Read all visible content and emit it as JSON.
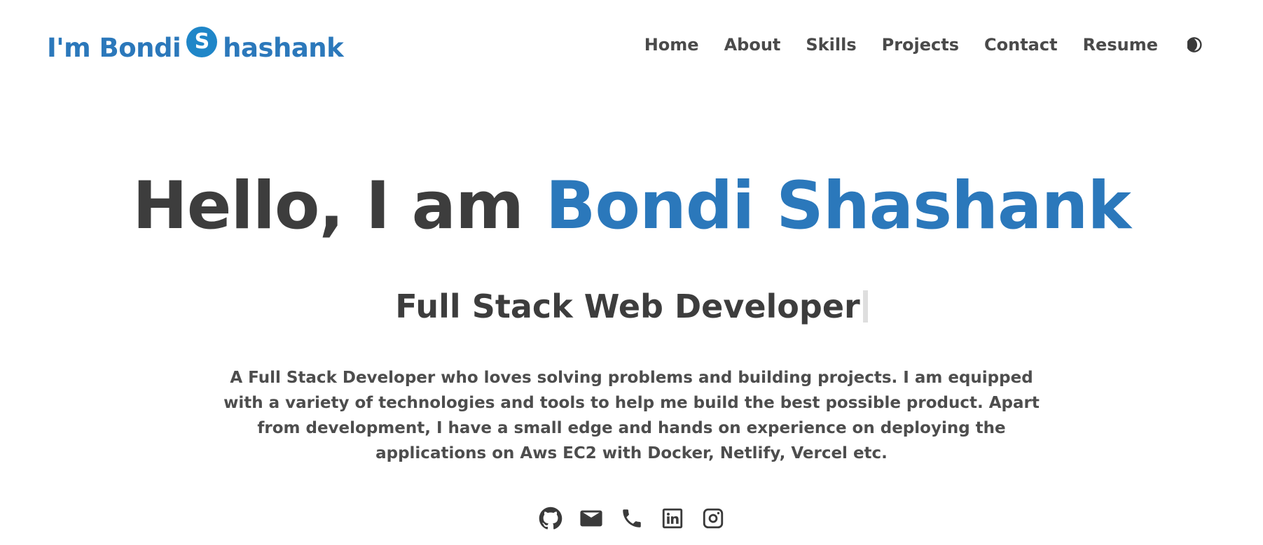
{
  "brand": {
    "prefix": "I'm Bondi",
    "badge": "S",
    "suffix": "hashank"
  },
  "nav": {
    "items": [
      {
        "label": "Home"
      },
      {
        "label": "About"
      },
      {
        "label": "Skills"
      },
      {
        "label": "Projects"
      },
      {
        "label": "Contact"
      },
      {
        "label": "Resume"
      }
    ],
    "theme_toggle_icon": "moon-icon"
  },
  "hero": {
    "greeting": "Hello, I am ",
    "name": "Bondi Shashank",
    "role": "Full Stack Web Developer",
    "bio": "A Full Stack Developer who loves solving problems and building projects. I am equipped with a variety of technologies and tools to help me build the best possible product. Apart from development, I have a small edge and hands on experience on deploying the applications on Aws EC2 with Docker, Netlify, Vercel etc."
  },
  "socials": [
    {
      "icon": "github-icon"
    },
    {
      "icon": "mail-icon"
    },
    {
      "icon": "phone-icon"
    },
    {
      "icon": "linkedin-icon"
    },
    {
      "icon": "instagram-icon"
    }
  ],
  "colors": {
    "accent": "#2b78bb",
    "badge": "#1f86c8",
    "text": "#3d3d3d",
    "background": "#ffffff"
  }
}
